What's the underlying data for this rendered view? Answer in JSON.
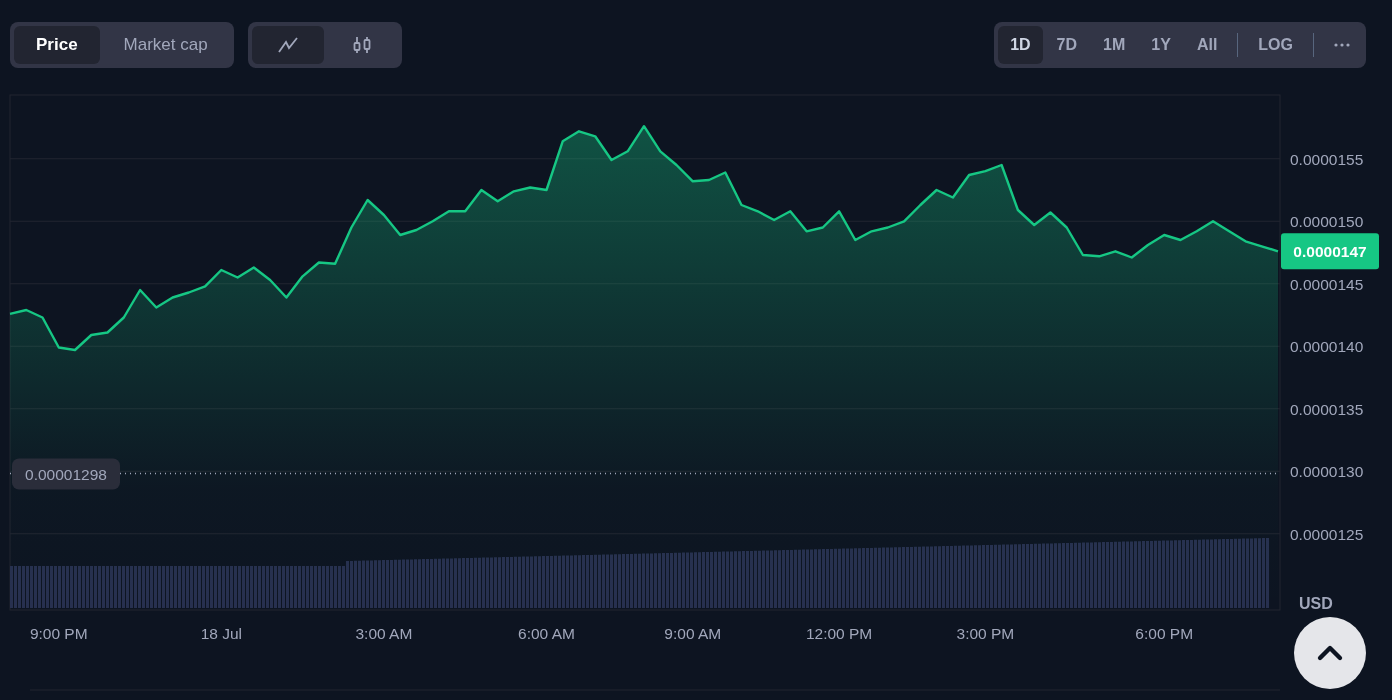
{
  "toolbar": {
    "metric_tabs": [
      {
        "label": "Price",
        "selected": true
      },
      {
        "label": "Market cap",
        "selected": false
      }
    ],
    "chart_type_tabs": [
      {
        "kind": "line",
        "selected": true
      },
      {
        "kind": "candles",
        "selected": false
      }
    ],
    "range_tabs": [
      {
        "label": "1D",
        "selected": true
      },
      {
        "label": "7D",
        "selected": false
      },
      {
        "label": "1M",
        "selected": false
      },
      {
        "label": "1Y",
        "selected": false
      },
      {
        "label": "All",
        "selected": false
      }
    ],
    "log_button": {
      "label": "LOG"
    }
  },
  "chart": {
    "currency": "USD",
    "chart_data": {
      "type": "area",
      "grid": true,
      "ylim": [
        1.189e-05,
        1.601e-05
      ],
      "yticks": [
        {
          "value": 1.25e-05,
          "label": "0.0000125"
        },
        {
          "value": 1.3e-05,
          "label": "0.0000130"
        },
        {
          "value": 1.35e-05,
          "label": "0.0000135"
        },
        {
          "value": 1.4e-05,
          "label": "0.0000140"
        },
        {
          "value": 1.45e-05,
          "label": "0.0000145"
        },
        {
          "value": 1.5e-05,
          "label": "0.0000150"
        },
        {
          "value": 1.55e-05,
          "label": "0.0000155"
        }
      ],
      "categories": [
        null,
        null,
        null,
        "9:00 PM",
        null,
        null,
        null,
        null,
        null,
        null,
        null,
        null,
        null,
        "18 Jul",
        null,
        null,
        null,
        null,
        null,
        null,
        null,
        null,
        null,
        "3:00 AM",
        null,
        null,
        null,
        null,
        null,
        null,
        null,
        null,
        null,
        "6:00 AM",
        null,
        null,
        null,
        null,
        null,
        null,
        null,
        null,
        "9:00 AM",
        null,
        null,
        null,
        null,
        null,
        null,
        null,
        null,
        "12:00 PM",
        null,
        null,
        null,
        null,
        null,
        null,
        null,
        null,
        "3:00 PM",
        null,
        null,
        null,
        null,
        null,
        null,
        null,
        null,
        null,
        null,
        "6:00 PM",
        null,
        null,
        null,
        null,
        null,
        null,
        null
      ],
      "series": [
        {
          "color": "#16c784",
          "values": [
            1.426e-05,
            1.429e-05,
            1.423e-05,
            1.399e-05,
            1.397e-05,
            1.409e-05,
            1.411e-05,
            1.423e-05,
            1.445e-05,
            1.431e-05,
            1.439e-05,
            1.443e-05,
            1.448e-05,
            1.461e-05,
            1.455e-05,
            1.463e-05,
            1.453e-05,
            1.439e-05,
            1.456e-05,
            1.467e-05,
            1.466e-05,
            1.495e-05,
            1.517e-05,
            1.505e-05,
            1.489e-05,
            1.493e-05,
            1.5e-05,
            1.508e-05,
            1.508e-05,
            1.525e-05,
            1.516e-05,
            1.524e-05,
            1.527e-05,
            1.525e-05,
            1.564e-05,
            1.572e-05,
            1.568e-05,
            1.549e-05,
            1.556e-05,
            1.576e-05,
            1.556e-05,
            1.545e-05,
            1.532e-05,
            1.533e-05,
            1.539e-05,
            1.513e-05,
            1.508e-05,
            1.501e-05,
            1.508e-05,
            1.492e-05,
            1.495e-05,
            1.508e-05,
            1.485e-05,
            1.492e-05,
            1.495e-05,
            1.5e-05,
            1.513e-05,
            1.525e-05,
            1.519e-05,
            1.537e-05,
            1.54e-05,
            1.545e-05,
            1.509e-05,
            1.497e-05,
            1.507e-05,
            1.495e-05,
            1.473e-05,
            1.472e-05,
            1.476e-05,
            1.471e-05,
            1.481e-05,
            1.489e-05,
            1.485e-05,
            1.492e-05,
            1.5e-05,
            1.492e-05,
            1.484e-05,
            1.48e-05,
            1.476e-05
          ]
        }
      ]
    },
    "low_marker": {
      "label": "0.00001298"
    },
    "current_price": {
      "label": "0.0000147"
    }
  }
}
